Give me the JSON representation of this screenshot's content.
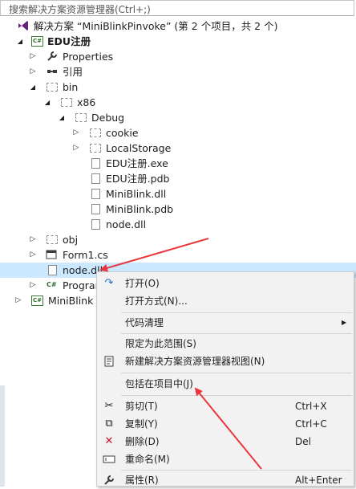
{
  "search": {
    "placeholder": "搜索解决方案资源管理器(Ctrl+;)"
  },
  "tree": {
    "solution": "解决方案 “MiniBlinkPinvoke” (第 2 个项目，共 2 个)",
    "project": "EDU注册",
    "properties": "Properties",
    "references": "引用",
    "bin": "bin",
    "x86": "x86",
    "debug": "Debug",
    "cookie": "cookie",
    "localstorage": "LocalStorage",
    "files": [
      "EDU注册.exe",
      "EDU注册.pdb",
      "MiniBlink.dll",
      "MiniBlink.pdb",
      "node.dll"
    ],
    "obj": "obj",
    "form1": "Form1.cs",
    "node_selected": "node.dll",
    "program": "Program.cs",
    "miniblink": "MiniBlink",
    "cs_badge": "C#"
  },
  "menu": {
    "open": "打开(O)",
    "open_with": "打开方式(N)...",
    "code_cleanup": "代码清理",
    "scope": "限定为此范围(S)",
    "new_view": "新建解决方案资源管理器视图(N)",
    "include": "包括在项目中(J)",
    "cut": "剪切(T)",
    "cut_key": "Ctrl+X",
    "copy": "复制(Y)",
    "copy_key": "Ctrl+C",
    "delete": "删除(D)",
    "delete_key": "Del",
    "rename": "重命名(M)",
    "properties": "属性(R)",
    "properties_key": "Alt+Enter"
  },
  "colors": {
    "selection": "#cce8ff",
    "annotation_arrow": "#e8383d",
    "vs_purple": "#68217a"
  }
}
